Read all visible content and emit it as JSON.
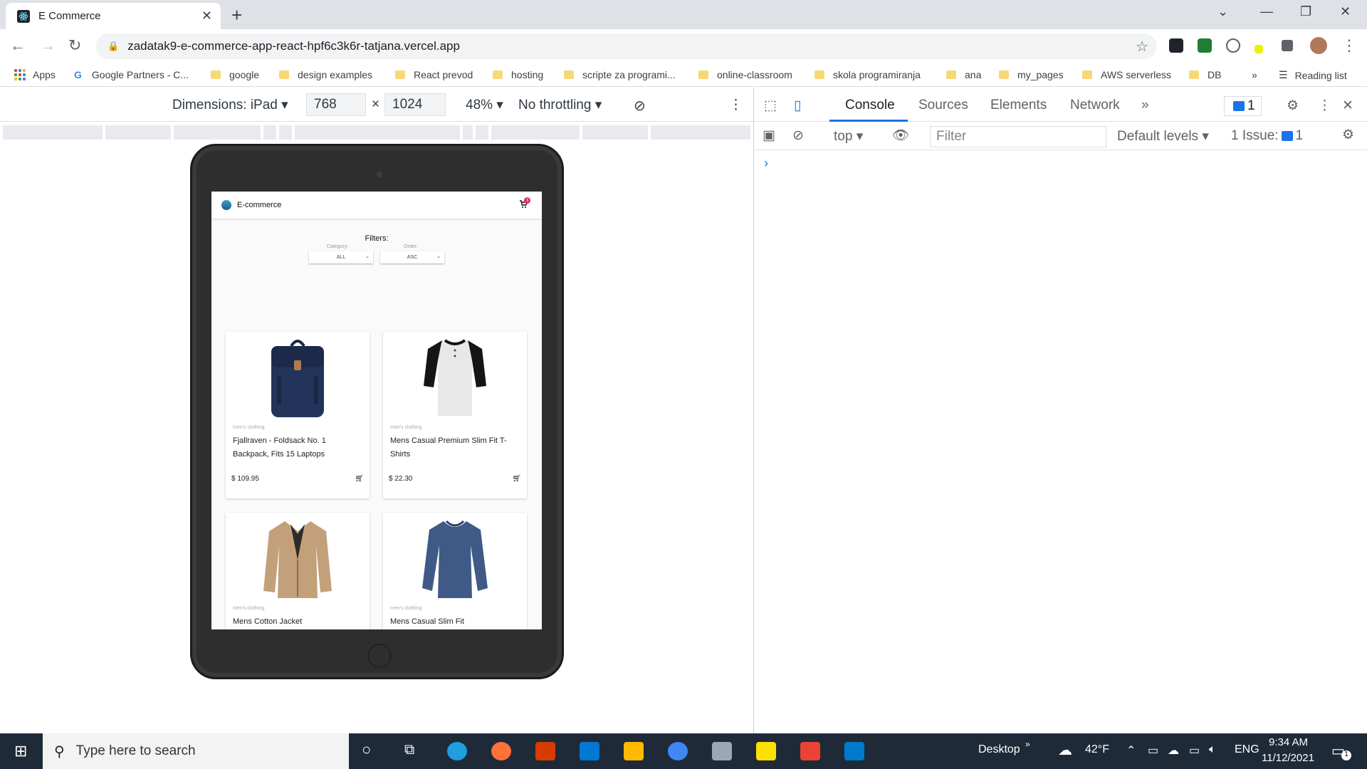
{
  "browser": {
    "tab_title": "E Commerce",
    "url": "zadatak9-e-commerce-app-react-hpf6c3k6r-tatjana.vercel.app",
    "bookmarks": [
      {
        "label": "Apps",
        "kind": "apps"
      },
      {
        "label": "Google Partners - C...",
        "kind": "google"
      },
      {
        "label": "google",
        "kind": "folder"
      },
      {
        "label": "design examples",
        "kind": "folder"
      },
      {
        "label": "React prevod",
        "kind": "folder"
      },
      {
        "label": "hosting",
        "kind": "folder"
      },
      {
        "label": "scripte za programi...",
        "kind": "folder"
      },
      {
        "label": "online-classroom",
        "kind": "folder"
      },
      {
        "label": "skola programiranja",
        "kind": "folder"
      },
      {
        "label": "ana",
        "kind": "folder"
      },
      {
        "label": "my_pages",
        "kind": "folder"
      },
      {
        "label": "AWS serverless",
        "kind": "folder"
      },
      {
        "label": "DB",
        "kind": "folder"
      }
    ],
    "reading_list": "Reading list",
    "more_bookmarks": "»"
  },
  "device_toolbar": {
    "dimensions": "Dimensions: iPad",
    "width": "768",
    "times": "×",
    "height": "1024",
    "zoom": "48%",
    "throttling": "No throttling"
  },
  "app": {
    "brand": "E-commerce",
    "cart_count": "3",
    "filters_title": "Filters:",
    "category_label": "Category:",
    "category_value": "ALL",
    "order_label": "Order:",
    "order_value": "ASC",
    "products": [
      {
        "category": "men's clothing",
        "name": "Fjallraven - Foldsack No. 1 Backpack, Fits 15 Laptops",
        "price": "$ 109.95"
      },
      {
        "category": "men's clothing",
        "name": "Mens Casual Premium Slim Fit T-Shirts",
        "price": "$ 22.30"
      },
      {
        "category": "men's clothing",
        "name": "Mens Cotton Jacket",
        "price": ""
      },
      {
        "category": "men's clothing",
        "name": "Mens Casual Slim Fit",
        "price": ""
      }
    ]
  },
  "devtools": {
    "tabs": [
      "Console",
      "Sources",
      "Elements",
      "Network"
    ],
    "more": "»",
    "message_count": "1",
    "context": "top",
    "filter_placeholder": "Filter",
    "levels": "Default levels",
    "issues_label": "1 Issue:",
    "issues_count": "1",
    "prompt": "›"
  },
  "taskbar": {
    "search_placeholder": "Type here to search",
    "desktop": "Desktop",
    "weather": "42°F",
    "lang": "ENG",
    "time": "9:34 AM",
    "date": "11/12/2021",
    "notif_count": "1"
  },
  "colors": {
    "accent": "#1a73e8",
    "badge": "#e91e63",
    "taskbar": "#1f2a38"
  }
}
